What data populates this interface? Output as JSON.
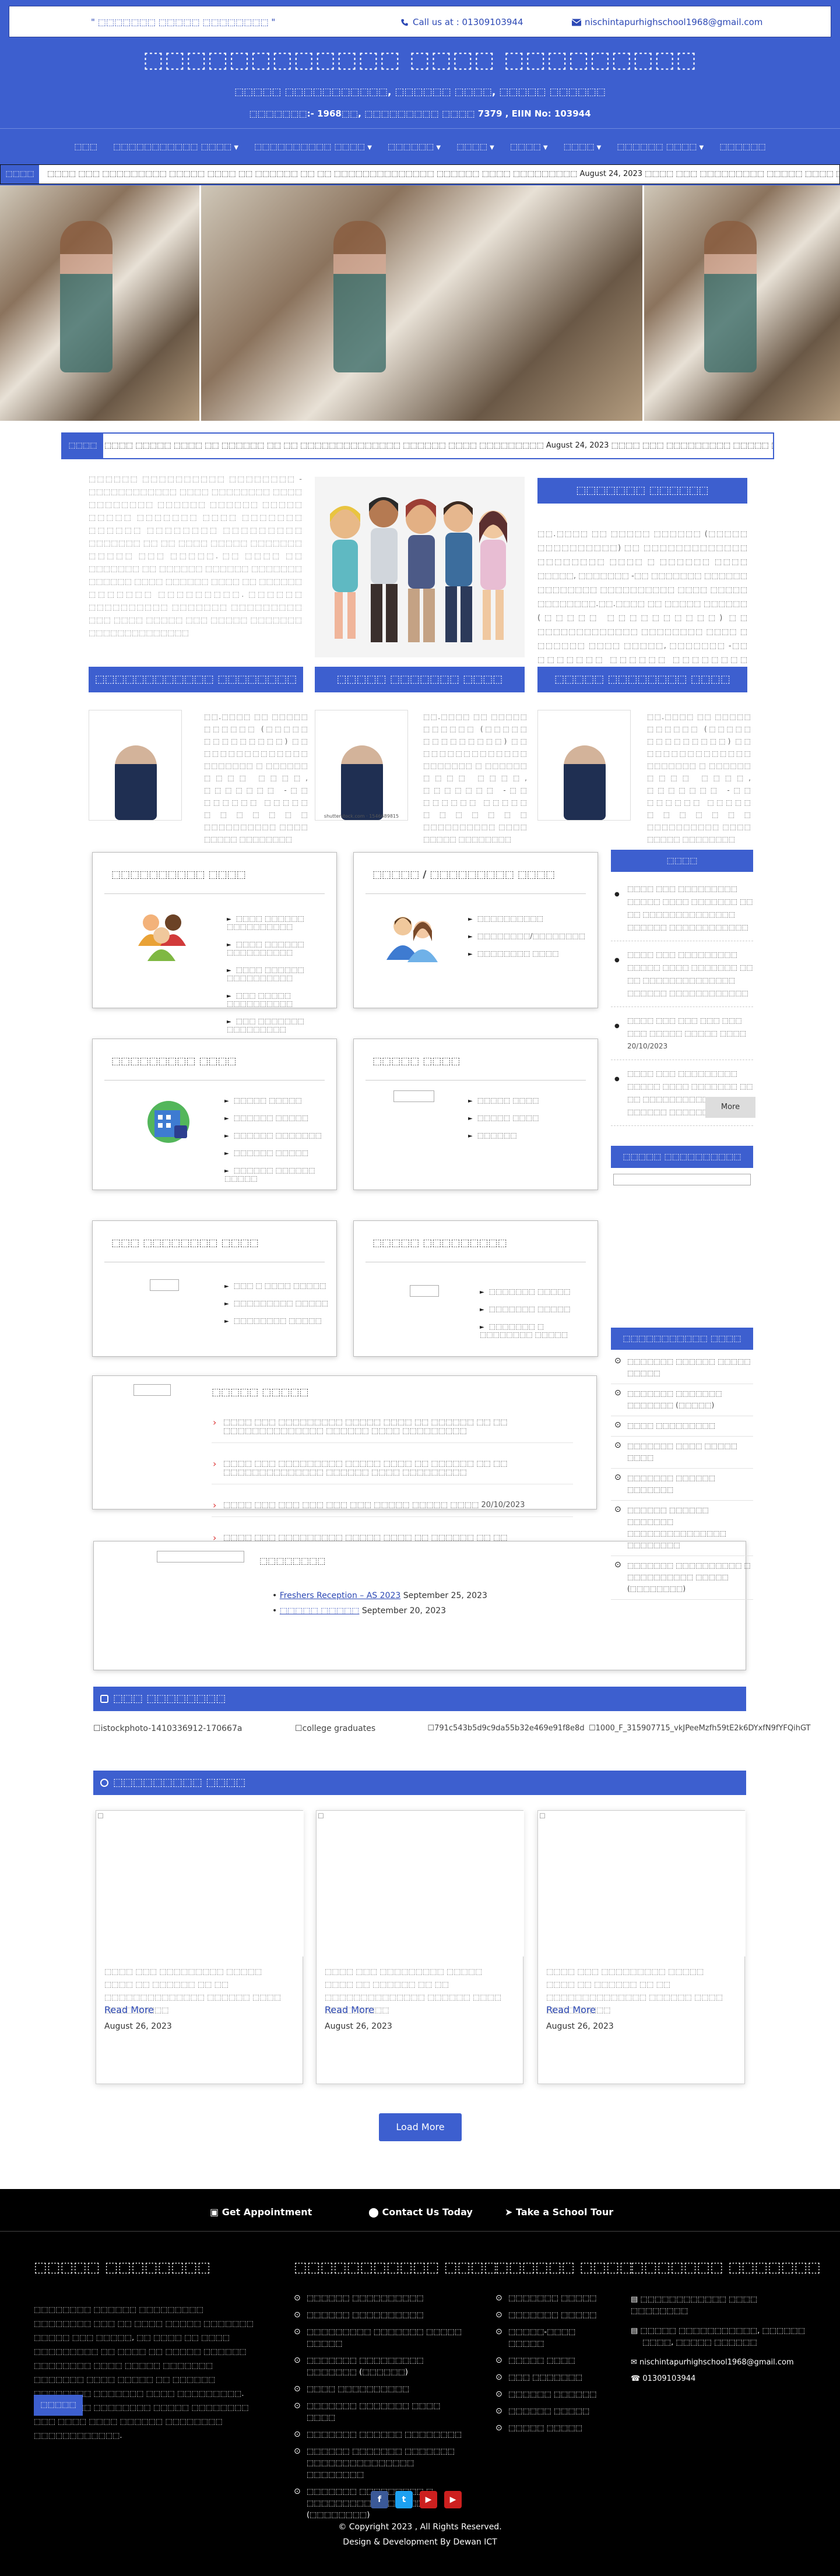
{
  "header": {
    "slogan": "\" ⬚⬚⬚⬚⬚⬚⬚ ⬚⬚⬚⬚⬚ ⬚⬚⬚⬚⬚⬚⬚⬚ \"",
    "call": "Call us at : 01309103944",
    "email": "nischintapurhighschool1968@gmail.com",
    "school_name": "⬚⬚⬚⬚⬚⬚⬚⬚⬚⬚⬚⬚ ⬚⬚⬚⬚ ⬚⬚⬚⬚⬚⬚⬚⬚⬚",
    "address": "⬚⬚⬚⬚⬚ ⬚⬚⬚⬚⬚⬚⬚⬚⬚⬚⬚, ⬚⬚⬚⬚⬚⬚ ⬚⬚⬚⬚, ⬚⬚⬚⬚⬚ ⬚⬚⬚⬚⬚⬚",
    "codes": "⬚⬚⬚⬚⬚⬚⬚:- 1968⬚⬚,   ⬚⬚⬚⬚⬚⬚⬚⬚⬚ ⬚⬚⬚⬚ 7379 ,   EIIN No: 103944",
    "colors": {
      "brand": "#3d5fcf",
      "footer": "#000000"
    }
  },
  "nav": {
    "items": [
      {
        "label": "⬚⬚⬚",
        "dropdown": false
      },
      {
        "label": "⬚⬚⬚⬚⬚⬚⬚⬚⬚⬚⬚ ⬚⬚⬚⬚",
        "dropdown": true
      },
      {
        "label": "⬚⬚⬚⬚⬚⬚⬚⬚⬚⬚ ⬚⬚⬚⬚",
        "dropdown": true
      },
      {
        "label": "⬚⬚⬚⬚⬚⬚",
        "dropdown": true
      },
      {
        "label": "⬚⬚⬚⬚",
        "dropdown": true
      },
      {
        "label": "⬚⬚⬚⬚",
        "dropdown": true
      },
      {
        "label": "⬚⬚⬚⬚",
        "dropdown": true
      },
      {
        "label": "⬚⬚⬚⬚⬚⬚ ⬚⬚⬚⬚",
        "dropdown": true
      },
      {
        "label": "⬚⬚⬚⬚⬚⬚",
        "dropdown": false
      }
    ]
  },
  "ticker": {
    "label": "⬚⬚⬚⬚",
    "text": "⬚⬚⬚⬚ ⬚⬚⬚ ⬚⬚⬚⬚⬚⬚⬚⬚⬚ ⬚⬚⬚⬚⬚ ⬚⬚⬚⬚ ⬚⬚ ⬚⬚⬚⬚⬚⬚ ⬚⬚ ⬚⬚ ⬚⬚⬚⬚⬚⬚⬚⬚⬚⬚⬚⬚⬚⬚ ⬚⬚⬚⬚⬚⬚ ⬚⬚⬚⬚ ⬚⬚⬚⬚⬚⬚⬚⬚⬚     August 24, 2023 ⬚⬚⬚⬚ ⬚⬚⬚ ⬚⬚⬚⬚⬚⬚⬚⬚⬚ ⬚⬚⬚⬚⬚ ⬚⬚⬚⬚ ⬚⬚ ⬚⬚⬚⬚⬚⬚ ⬚⬚ ⬚⬚ ⬚⬚⬚⬚⬚⬚⬚⬚⬚⬚⬚⬚⬚⬚ ⬚⬚⬚⬚⬚⬚ ⬚⬚⬚⬚ ⬚⬚⬚⬚⬚⬚⬚⬚⬚     August 24, 2023 ⬚⬚⬚⬚ ⬚⬚⬚ ⬚⬚⬚⬚⬚⬚⬚⬚⬚ ⬚⬚⬚⬚"
  },
  "notice_ticker": {
    "label": "⬚⬚⬚⬚",
    "text": "⬚⬚⬚⬚ ⬚⬚⬚⬚⬚ ⬚⬚⬚⬚ ⬚⬚ ⬚⬚⬚⬚⬚⬚ ⬚⬚ ⬚⬚ ⬚⬚⬚⬚⬚⬚⬚⬚⬚⬚⬚⬚⬚⬚ ⬚⬚⬚⬚⬚⬚ ⬚⬚⬚⬚ ⬚⬚⬚⬚⬚⬚⬚⬚⬚   August 24, 2023 ⬚⬚⬚⬚ ⬚⬚⬚ ⬚⬚⬚⬚⬚⬚⬚⬚⬚ ⬚⬚⬚⬚⬚ ⬚⬚⬚⬚ ⬚⬚ ⬚⬚⬚⬚⬚⬚ ⬚⬚ ⬚⬚ ⬚⬚⬚⬚⬚⬚⬚⬚⬚⬚⬚⬚⬚⬚ ⬚⬚⬚⬚⬚⬚ ⬚⬚⬚⬚ ⬚⬚⬚⬚⬚⬚⬚⬚⬚   August 2"
  },
  "intro": {
    "text": "⬚⬚⬚⬚⬚⬚ ⬚⬚⬚⬚⬚⬚⬚⬚⬚⬚ ⬚⬚⬚⬚⬚⬚⬚⬚ - ⬚⬚⬚⬚⬚⬚⬚⬚⬚⬚⬚⬚ ⬚⬚⬚⬚ ⬚⬚⬚⬚⬚⬚⬚⬚ ⬚⬚⬚⬚ ⬚⬚⬚⬚⬚⬚⬚⬚ ⬚⬚⬚⬚⬚⬚ ⬚⬚⬚⬚⬚⬚ ⬚⬚⬚⬚⬚ ⬚⬚⬚⬚⬚ ⬚⬚⬚⬚⬚⬚⬚ ⬚⬚⬚⬚ ⬚⬚⬚⬚⬚⬚⬚ ⬚⬚⬚⬚⬚⬚ ⬚⬚⬚⬚⬚⬚⬚⬚ ⬚⬚⬚⬚⬚⬚⬚⬚⬚ ⬚⬚⬚⬚⬚⬚⬚ ⬚⬚ ⬚⬚ ⬚⬚⬚⬚ ⬚⬚⬚⬚⬚ ⬚⬚⬚⬚⬚⬚⬚ ⬚⬚⬚⬚⬚ ⬚⬚⬚ ⬚⬚⬚⬚⬚. ⬚⬚ ⬚⬚⬚⬚ ⬚⬚ ⬚⬚⬚⬚⬚⬚⬚ ⬚⬚ ⬚⬚⬚⬚⬚⬚ ⬚⬚⬚⬚⬚⬚ ⬚⬚⬚⬚⬚⬚⬚ ⬚⬚⬚⬚⬚⬚ ⬚⬚⬚⬚ ⬚⬚⬚⬚⬚⬚ ⬚⬚⬚⬚ ⬚⬚ ⬚⬚⬚⬚⬚⬚ ⬚⬚⬚⬚⬚⬚⬚ ⬚⬚⬚⬚⬚⬚⬚⬚⬚. ⬚⬚⬚⬚⬚⬚ ⬚⬚⬚⬚⬚⬚⬚⬚⬚⬚ ⬚⬚⬚⬚⬚⬚⬚ ⬚⬚⬚⬚⬚⬚⬚⬚⬚ ⬚⬚⬚ ⬚⬚⬚⬚ ⬚⬚⬚⬚⬚ ⬚⬚⬚ ⬚⬚⬚⬚⬚ ⬚⬚⬚⬚⬚⬚⬚ ⬚⬚⬚⬚⬚⬚⬚⬚⬚⬚⬚⬚⬚⬚"
  },
  "headmaster": {
    "title": "⬚⬚⬚⬚⬚⬚⬚ ⬚⬚⬚⬚⬚⬚",
    "text": "⬚⬚.⬚⬚⬚⬚ ⬚⬚ ⬚⬚⬚⬚⬚ ⬚⬚⬚⬚⬚⬚ (⬚⬚⬚⬚⬚ ⬚⬚⬚⬚⬚⬚⬚⬚⬚⬚) ⬚⬚ ⬚⬚⬚⬚⬚⬚⬚⬚⬚⬚⬚⬚⬚ ⬚⬚⬚⬚⬚⬚⬚⬚ ⬚⬚⬚⬚ ⬚ ⬚⬚⬚⬚⬚⬚ ⬚⬚⬚⬚ ⬚⬚⬚⬚⬚, ⬚⬚⬚⬚⬚⬚⬚ -⬚⬚ ⬚⬚⬚⬚⬚⬚⬚ ⬚⬚⬚⬚⬚⬚ ⬚⬚⬚⬚⬚⬚⬚⬚ ⬚⬚⬚⬚⬚⬚⬚⬚⬚⬚ ⬚⬚⬚⬚ ⬚⬚⬚⬚⬚ ⬚⬚⬚⬚⬚⬚⬚⬚.⬚⬚.⬚⬚⬚⬚ ⬚⬚ ⬚⬚⬚⬚⬚ ⬚⬚⬚⬚⬚⬚ (⬚⬚⬚⬚⬚ ⬚⬚⬚⬚⬚⬚⬚⬚⬚⬚) ⬚⬚ ⬚⬚⬚⬚⬚⬚⬚⬚⬚⬚⬚⬚⬚ ⬚⬚⬚⬚⬚⬚⬚⬚ ⬚⬚⬚⬚ ⬚ ⬚⬚⬚⬚⬚⬚ ⬚⬚⬚⬚ ⬚⬚⬚⬚⬚, ⬚⬚⬚⬚⬚⬚⬚ -⬚⬚ ⬚⬚⬚⬚⬚⬚⬚ ⬚⬚⬚⬚⬚⬚ ⬚⬚⬚⬚⬚⬚⬚⬚ ⬚⬚⬚⬚⬚⬚⬚⬚⬚⬚ ⬚⬚⬚⬚ ⬚⬚⬚⬚⬚⬚⬚⬚⬚."
  },
  "people": [
    {
      "title": "⬚⬚⬚⬚⬚⬚⬚⬚⬚⬚⬚⬚ ⬚⬚⬚⬚⬚⬚⬚⬚",
      "text": "⬚⬚.⬚⬚⬚⬚ ⬚⬚ ⬚⬚⬚⬚⬚ ⬚⬚⬚⬚⬚⬚ (⬚⬚⬚⬚⬚ ⬚⬚⬚⬚⬚⬚⬚⬚⬚) ⬚⬚ ⬚⬚⬚⬚⬚⬚⬚⬚⬚⬚⬚⬚⬚ ⬚⬚⬚⬚⬚⬚⬚ ⬚ ⬚⬚⬚⬚⬚⬚ ⬚⬚⬚⬚ ⬚⬚⬚⬚, ⬚⬚⬚⬚⬚⬚⬚ -⬚⬚ ⬚⬚⬚⬚⬚⬚ ⬚⬚⬚⬚⬚ ⬚⬚⬚⬚⬚⬚⬚ ⬚⬚⬚⬚⬚⬚⬚⬚⬚⬚ ⬚⬚⬚⬚ ⬚⬚⬚⬚⬚ ⬚⬚⬚⬚⬚⬚⬚⬚",
      "img_caption": ""
    },
    {
      "title": "⬚⬚⬚⬚⬚ ⬚⬚⬚⬚⬚⬚⬚ ⬚⬚⬚⬚",
      "text": "⬚⬚.⬚⬚⬚⬚ ⬚⬚ ⬚⬚⬚⬚⬚ ⬚⬚⬚⬚⬚⬚ (⬚⬚⬚⬚⬚ ⬚⬚⬚⬚⬚⬚⬚⬚⬚) ⬚⬚ ⬚⬚⬚⬚⬚⬚⬚⬚⬚⬚⬚⬚⬚ ⬚⬚⬚⬚⬚⬚⬚ ⬚ ⬚⬚⬚⬚⬚⬚ ⬚⬚⬚⬚ ⬚⬚⬚⬚, ⬚⬚⬚⬚⬚⬚⬚ -⬚⬚ ⬚⬚⬚⬚⬚⬚ ⬚⬚⬚⬚⬚ ⬚⬚⬚⬚⬚⬚⬚ ⬚⬚⬚⬚⬚⬚⬚⬚⬚⬚ ⬚⬚⬚⬚ ⬚⬚⬚⬚⬚ ⬚⬚⬚⬚⬚⬚⬚⬚",
      "img_caption": "shutterstock.com · 1546689815"
    },
    {
      "title": "⬚⬚⬚⬚⬚ ⬚⬚⬚⬚⬚⬚⬚⬚ ⬚⬚⬚⬚",
      "text": "⬚⬚.⬚⬚⬚⬚ ⬚⬚ ⬚⬚⬚⬚⬚ ⬚⬚⬚⬚⬚⬚ (⬚⬚⬚⬚⬚ ⬚⬚⬚⬚⬚⬚⬚⬚⬚) ⬚⬚ ⬚⬚⬚⬚⬚⬚⬚⬚⬚⬚⬚⬚⬚ ⬚⬚⬚⬚⬚⬚⬚ ⬚ ⬚⬚⬚⬚⬚⬚ ⬚⬚⬚⬚ ⬚⬚⬚⬚, ⬚⬚⬚⬚⬚⬚⬚ -⬚⬚ ⬚⬚⬚⬚⬚⬚ ⬚⬚⬚⬚⬚ ⬚⬚⬚⬚⬚⬚⬚ ⬚⬚⬚⬚⬚⬚⬚⬚⬚⬚ ⬚⬚⬚⬚ ⬚⬚⬚⬚⬚ ⬚⬚⬚⬚⬚⬚⬚⬚",
      "img_caption": ""
    }
  ],
  "cards": [
    {
      "title": "⬚⬚⬚⬚⬚⬚⬚⬚⬚⬚ ⬚⬚⬚⬚",
      "items": [
        "⬚⬚⬚⬚ ⬚⬚⬚⬚⬚⬚ ⬚⬚⬚⬚⬚⬚⬚⬚⬚⬚",
        "⬚⬚⬚⬚ ⬚⬚⬚⬚⬚⬚ ⬚⬚⬚⬚⬚⬚⬚⬚⬚⬚",
        "⬚⬚⬚⬚ ⬚⬚⬚⬚⬚⬚ ⬚⬚⬚⬚⬚⬚⬚⬚⬚⬚",
        "⬚⬚⬚ ⬚⬚⬚⬚⬚ ⬚⬚⬚⬚⬚⬚⬚⬚⬚⬚",
        "⬚⬚⬚ ⬚⬚⬚⬚⬚⬚⬚ ⬚⬚⬚⬚⬚⬚⬚⬚⬚"
      ]
    },
    {
      "title": "⬚⬚⬚⬚⬚ / ⬚⬚⬚⬚⬚⬚⬚⬚⬚ ⬚⬚⬚⬚",
      "items": [
        "⬚⬚⬚⬚⬚⬚⬚⬚⬚⬚",
        "⬚⬚⬚⬚⬚⬚⬚⬚/⬚⬚⬚⬚⬚⬚⬚⬚",
        "⬚⬚⬚⬚⬚⬚⬚⬚ ⬚⬚⬚⬚"
      ]
    },
    {
      "title": "⬚⬚⬚⬚⬚⬚⬚⬚⬚ ⬚⬚⬚⬚",
      "items": [
        "⬚⬚⬚⬚⬚ ⬚⬚⬚⬚⬚",
        "⬚⬚⬚⬚⬚⬚ ⬚⬚⬚⬚⬚",
        "⬚⬚⬚⬚⬚⬚ ⬚⬚⬚⬚⬚⬚⬚",
        "⬚⬚⬚⬚⬚⬚ ⬚⬚⬚⬚⬚",
        "⬚⬚⬚⬚⬚⬚ ⬚⬚⬚⬚⬚⬚ ⬚⬚⬚⬚⬚"
      ]
    },
    {
      "title": "⬚⬚⬚⬚⬚ ⬚⬚⬚⬚",
      "items": [
        "⬚⬚⬚⬚⬚ ⬚⬚⬚⬚",
        "⬚⬚⬚⬚⬚ ⬚⬚⬚⬚",
        "⬚⬚⬚⬚⬚⬚"
      ]
    },
    {
      "title": "⬚⬚⬚ ⬚⬚⬚⬚⬚⬚⬚⬚ ⬚⬚⬚⬚",
      "items": [
        "⬚⬚⬚ ⬚ ⬚⬚⬚⬚ ⬚⬚⬚⬚⬚",
        "⬚⬚⬚⬚⬚⬚⬚⬚⬚ ⬚⬚⬚⬚⬚",
        "⬚⬚⬚⬚⬚⬚⬚⬚ ⬚⬚⬚⬚⬚"
      ]
    },
    {
      "title": "⬚⬚⬚⬚⬚ ⬚⬚⬚⬚⬚⬚⬚⬚⬚",
      "items": [
        "⬚⬚⬚⬚⬚⬚⬚ ⬚⬚⬚⬚⬚",
        "⬚⬚⬚⬚⬚⬚⬚ ⬚⬚⬚⬚⬚",
        "⬚⬚⬚⬚⬚⬚⬚ ⬚ ⬚⬚⬚⬚⬚⬚⬚⬚ ⬚⬚⬚⬚⬚"
      ]
    }
  ],
  "notice_card": {
    "title": "⬚⬚⬚⬚⬚ ⬚⬚⬚⬚⬚",
    "items": [
      "⬚⬚⬚⬚ ⬚⬚⬚ ⬚⬚⬚⬚⬚⬚⬚⬚⬚ ⬚⬚⬚⬚⬚ ⬚⬚⬚⬚ ⬚⬚ ⬚⬚⬚⬚⬚⬚ ⬚⬚ ⬚⬚ ⬚⬚⬚⬚⬚⬚⬚⬚⬚⬚⬚⬚⬚⬚ ⬚⬚⬚⬚⬚⬚ ⬚⬚⬚⬚ ⬚⬚⬚⬚⬚⬚⬚⬚⬚",
      "⬚⬚⬚⬚ ⬚⬚⬚ ⬚⬚⬚⬚⬚⬚⬚⬚⬚ ⬚⬚⬚⬚⬚ ⬚⬚⬚⬚ ⬚⬚ ⬚⬚⬚⬚⬚⬚ ⬚⬚ ⬚⬚ ⬚⬚⬚⬚⬚⬚⬚⬚⬚⬚⬚⬚⬚⬚ ⬚⬚⬚⬚⬚⬚ ⬚⬚⬚⬚ ⬚⬚⬚⬚⬚⬚⬚⬚⬚",
      "⬚⬚⬚⬚ ⬚⬚⬚ ⬚⬚⬚ ⬚⬚⬚ ⬚⬚⬚ ⬚⬚⬚ ⬚⬚⬚⬚⬚ ⬚⬚⬚⬚⬚ ⬚⬚⬚⬚ 20/10/2023",
      "⬚⬚⬚⬚ ⬚⬚⬚ ⬚⬚⬚⬚⬚⬚⬚⬚⬚ ⬚⬚⬚⬚⬚ ⬚⬚⬚⬚ ⬚⬚ ⬚⬚⬚⬚⬚⬚ ⬚⬚ ⬚⬚ ⬚⬚⬚⬚⬚⬚⬚⬚⬚⬚⬚⬚⬚⬚ ⬚⬚⬚⬚⬚⬚ ⬚⬚⬚⬚ ⬚⬚⬚⬚⬚⬚⬚⬚⬚"
    ]
  },
  "events": {
    "title": "⬚⬚⬚⬚⬚⬚⬚⬚",
    "items": [
      {
        "link": "Freshers Reception – AS 2023",
        "date": " September 25, 2023"
      },
      {
        "link": "⬚⬚⬚⬚⬚ ⬚⬚⬚⬚⬚",
        "date": " September 20, 2023"
      }
    ]
  },
  "sidebar": {
    "notice_title": "⬚⬚⬚⬚",
    "notices": [
      "⬚⬚⬚⬚ ⬚⬚⬚ ⬚⬚⬚⬚⬚⬚⬚⬚⬚ ⬚⬚⬚⬚⬚ ⬚⬚⬚⬚ ⬚⬚⬚⬚⬚⬚⬚ ⬚⬚ ⬚⬚ ⬚⬚⬚⬚⬚⬚⬚⬚⬚⬚⬚⬚⬚⬚ ⬚⬚⬚⬚⬚⬚ ⬚⬚⬚⬚⬚⬚⬚⬚⬚⬚⬚⬚",
      "⬚⬚⬚⬚ ⬚⬚⬚ ⬚⬚⬚⬚⬚⬚⬚⬚⬚ ⬚⬚⬚⬚⬚ ⬚⬚⬚⬚ ⬚⬚⬚⬚⬚⬚⬚ ⬚⬚ ⬚⬚ ⬚⬚⬚⬚⬚⬚⬚⬚⬚⬚⬚⬚⬚⬚ ⬚⬚⬚⬚⬚⬚ ⬚⬚⬚⬚⬚⬚⬚⬚⬚⬚⬚⬚",
      "⬚⬚⬚⬚ ⬚⬚⬚ ⬚⬚⬚ ⬚⬚⬚ ⬚⬚⬚ ⬚⬚⬚ ⬚⬚⬚⬚⬚ ⬚⬚⬚⬚⬚ ⬚⬚⬚⬚ 20/10/2023",
      "⬚⬚⬚⬚ ⬚⬚⬚ ⬚⬚⬚⬚⬚⬚⬚⬚⬚ ⬚⬚⬚⬚⬚ ⬚⬚⬚⬚ ⬚⬚⬚⬚⬚⬚⬚ ⬚⬚ ⬚⬚ ⬚⬚⬚⬚⬚⬚⬚⬚⬚⬚⬚⬚⬚⬚ ⬚⬚⬚⬚⬚⬚ ⬚⬚⬚⬚⬚⬚⬚⬚⬚⬚⬚⬚"
    ],
    "more_label": "More",
    "site_title": "⬚⬚⬚⬚⬚ ⬚⬚⬚⬚⬚⬚⬚⬚⬚⬚ ⬚⬚⬚⬚⬚",
    "inst_title": "⬚⬚⬚⬚⬚⬚⬚⬚⬚⬚⬚ ⬚⬚⬚⬚",
    "inst_items": [
      "⬚⬚⬚⬚⬚⬚⬚ ⬚⬚⬚⬚⬚⬚ ⬚⬚⬚⬚⬚ ⬚⬚⬚⬚⬚",
      "⬚⬚⬚⬚⬚⬚⬚ ⬚⬚⬚⬚⬚⬚⬚ ⬚⬚⬚⬚⬚⬚⬚ (⬚⬚⬚⬚⬚)",
      "⬚⬚⬚⬚ ⬚⬚⬚⬚⬚⬚⬚⬚⬚",
      "⬚⬚⬚⬚⬚⬚⬚ ⬚⬚⬚⬚ ⬚⬚⬚⬚⬚ ⬚⬚⬚⬚",
      "⬚⬚⬚⬚⬚⬚⬚ ⬚⬚⬚⬚⬚⬚ ⬚⬚⬚⬚⬚⬚⬚",
      "⬚⬚⬚⬚⬚⬚ ⬚⬚⬚⬚⬚⬚ ⬚⬚⬚⬚⬚⬚⬚ ⬚⬚⬚⬚⬚⬚⬚⬚⬚⬚⬚⬚⬚⬚⬚ ⬚⬚⬚⬚⬚⬚⬚⬚",
      "⬚⬚⬚⬚⬚⬚⬚ ⬚⬚⬚⬚⬚⬚⬚⬚⬚⬚ ⬚ ⬚⬚⬚⬚⬚⬚⬚⬚⬚⬚ ⬚⬚⬚⬚⬚ (⬚⬚⬚⬚⬚⬚⬚⬚)"
    ]
  },
  "gallery": {
    "title": "⬚⬚⬚ ⬚⬚⬚⬚⬚⬚⬚⬚",
    "images": [
      "istockphoto-1410336912-170667a",
      "college graduates",
      "791c543b5d9c9da55b32e469e91f8e8d",
      "1000_F_315907715_vkJPeeMzfh59tE2k6DYxfN9fYFQihGT"
    ]
  },
  "news": {
    "title": "⬚⬚⬚⬚⬚⬚⬚⬚⬚ ⬚⬚⬚⬚",
    "items": [
      {
        "text": "⬚⬚⬚⬚ ⬚⬚⬚ ⬚⬚⬚⬚⬚⬚⬚⬚⬚ ⬚⬚⬚⬚⬚ ⬚⬚⬚⬚ ⬚⬚ ⬚⬚⬚⬚⬚⬚ ⬚⬚ ⬚⬚ ⬚⬚⬚⬚⬚⬚⬚⬚⬚⬚⬚⬚⬚⬚ ⬚⬚⬚⬚⬚⬚ ⬚⬚⬚⬚ ⬚⬚⬚⬚⬚⬚⬚⬚⬚",
        "read_more": "Read More",
        "date": "August 26, 2023"
      },
      {
        "text": "⬚⬚⬚⬚ ⬚⬚⬚ ⬚⬚⬚⬚⬚⬚⬚⬚⬚ ⬚⬚⬚⬚⬚ ⬚⬚⬚⬚ ⬚⬚ ⬚⬚⬚⬚⬚⬚ ⬚⬚ ⬚⬚ ⬚⬚⬚⬚⬚⬚⬚⬚⬚⬚⬚⬚⬚⬚ ⬚⬚⬚⬚⬚⬚ ⬚⬚⬚⬚ ⬚⬚⬚⬚⬚⬚⬚⬚⬚",
        "read_more": "Read More",
        "date": "August 26, 2023"
      },
      {
        "text": "⬚⬚⬚⬚ ⬚⬚⬚ ⬚⬚⬚⬚⬚⬚⬚⬚⬚ ⬚⬚⬚⬚⬚ ⬚⬚⬚⬚ ⬚⬚ ⬚⬚⬚⬚⬚⬚ ⬚⬚ ⬚⬚ ⬚⬚⬚⬚⬚⬚⬚⬚⬚⬚⬚⬚⬚⬚ ⬚⬚⬚⬚⬚⬚ ⬚⬚⬚⬚ ⬚⬚⬚⬚⬚⬚⬚⬚⬚",
        "read_more": "Read More",
        "date": "August 26, 2023"
      }
    ],
    "load_more": "Load More"
  },
  "footer": {
    "links": [
      "Get Appointment",
      "Contact Us Today",
      "Take a School Tour"
    ],
    "about_title": "⬚⬚⬚⬚⬚ ⬚⬚⬚⬚⬚⬚⬚⬚",
    "about_text": "⬚⬚⬚⬚⬚⬚⬚⬚ ⬚⬚⬚⬚⬚⬚ ⬚⬚⬚⬚⬚⬚⬚⬚⬚ ⬚⬚⬚⬚⬚⬚⬚⬚ ⬚⬚⬚ ⬚⬚ ⬚⬚⬚⬚ ⬚⬚⬚⬚⬚ ⬚⬚⬚⬚⬚⬚⬚ ⬚⬚⬚⬚⬚ ⬚⬚⬚ ⬚⬚⬚⬚⬚, ⬚⬚ ⬚⬚⬚⬚ ⬚⬚ ⬚⬚⬚⬚ ⬚⬚⬚⬚⬚⬚⬚⬚⬚ ⬚⬚ ⬚⬚⬚⬚ ⬚⬚ ⬚⬚⬚⬚⬚ ⬚⬚⬚⬚⬚⬚ ⬚⬚⬚⬚⬚⬚⬚⬚ ⬚⬚⬚⬚ ⬚⬚⬚⬚⬚ ⬚⬚⬚⬚⬚⬚⬚ ⬚⬚⬚⬚⬚⬚⬚ ⬚⬚⬚⬚ ⬚⬚⬚⬚⬚ ⬚⬚ ⬚⬚⬚⬚⬚⬚ ⬚⬚⬚⬚⬚⬚⬚⬚ ⬚⬚⬚⬚⬚⬚⬚ ⬚⬚⬚⬚ ⬚⬚⬚⬚⬚⬚⬚⬚⬚. ⬚⬚⬚⬚⬚⬚⬚⬚ ⬚⬚⬚⬚⬚⬚⬚⬚ ⬚⬚⬚⬚⬚ ⬚⬚⬚⬚⬚⬚⬚⬚ ⬚⬚⬚ ⬚⬚⬚⬚ ⬚⬚⬚⬚ ⬚⬚⬚⬚⬚⬚ ⬚⬚⬚⬚⬚⬚⬚⬚ ⬚⬚⬚⬚⬚⬚⬚⬚⬚⬚⬚⬚.",
    "about_btn": "⬚⬚⬚⬚⬚",
    "col2_title": "⬚⬚⬚⬚⬚⬚⬚⬚⬚⬚⬚ ⬚⬚⬚⬚",
    "col2_items": [
      "⬚⬚⬚⬚⬚⬚ ⬚⬚⬚⬚⬚⬚⬚⬚⬚⬚",
      "⬚⬚⬚⬚⬚⬚ ⬚⬚⬚⬚⬚⬚⬚⬚⬚⬚",
      "⬚⬚⬚⬚⬚⬚⬚⬚⬚ ⬚⬚⬚⬚⬚⬚⬚ ⬚⬚⬚⬚⬚ ⬚⬚⬚⬚⬚",
      "⬚⬚⬚⬚⬚⬚⬚ ⬚⬚⬚⬚⬚⬚⬚⬚⬚ ⬚⬚⬚⬚⬚⬚⬚ (⬚⬚⬚⬚⬚⬚)",
      "⬚⬚⬚⬚ ⬚⬚⬚⬚⬚⬚⬚⬚⬚⬚",
      "⬚⬚⬚⬚⬚⬚⬚ ⬚⬚⬚⬚⬚⬚⬚ ⬚⬚⬚⬚ ⬚⬚⬚⬚",
      "⬚⬚⬚⬚⬚⬚⬚ ⬚⬚⬚⬚⬚⬚ ⬚⬚⬚⬚⬚⬚⬚⬚",
      "⬚⬚⬚⬚⬚⬚ ⬚⬚⬚⬚⬚⬚⬚ ⬚⬚⬚⬚⬚⬚⬚ ⬚⬚⬚⬚⬚⬚⬚⬚⬚⬚⬚⬚⬚⬚⬚ ⬚⬚⬚⬚⬚⬚⬚⬚",
      "⬚⬚⬚⬚⬚⬚⬚ ⬚⬚⬚⬚⬚⬚⬚⬚⬚ ⬚ ⬚⬚⬚⬚⬚⬚⬚⬚⬚⬚⬚ ⬚⬚⬚⬚⬚ (⬚⬚⬚⬚⬚⬚⬚⬚)"
    ],
    "col3_title": "⬚⬚⬚⬚⬚⬚ ⬚⬚⬚⬚",
    "col3_items": [
      "⬚⬚⬚⬚⬚⬚⬚ ⬚⬚⬚⬚⬚",
      "⬚⬚⬚⬚⬚⬚⬚ ⬚⬚⬚⬚⬚",
      "⬚⬚⬚⬚⬚-⬚⬚⬚⬚ ⬚⬚⬚⬚⬚",
      "⬚⬚⬚⬚⬚ ⬚⬚⬚⬚",
      "⬚⬚⬚ ⬚⬚⬚⬚⬚⬚⬚",
      "⬚⬚⬚⬚⬚⬚ ⬚⬚⬚⬚⬚⬚",
      "⬚⬚⬚⬚⬚⬚ ⬚⬚⬚⬚⬚",
      "⬚⬚⬚⬚⬚ ⬚⬚⬚⬚⬚"
    ],
    "col4_title": "⬚⬚⬚⬚⬚⬚⬚ ⬚⬚⬚⬚⬚⬚⬚",
    "contact": [
      "⬚⬚⬚⬚⬚⬚⬚⬚⬚⬚⬚⬚ ⬚⬚⬚⬚ ⬚⬚⬚⬚⬚⬚⬚⬚",
      "⬚⬚⬚⬚⬚ ⬚⬚⬚⬚⬚⬚⬚⬚⬚⬚⬚, ⬚⬚⬚⬚⬚⬚ ⬚⬚⬚⬚, ⬚⬚⬚⬚⬚ ⬚⬚⬚⬚⬚⬚",
      "nischintapurhighschool1968@gmail.com",
      "01309103944"
    ],
    "social": [
      "f",
      "t",
      "▶",
      "▶"
    ],
    "copyright": "© Copyright 2023 , All Rights Reserved.",
    "credit": "Design & Development By Dewan ICT"
  }
}
